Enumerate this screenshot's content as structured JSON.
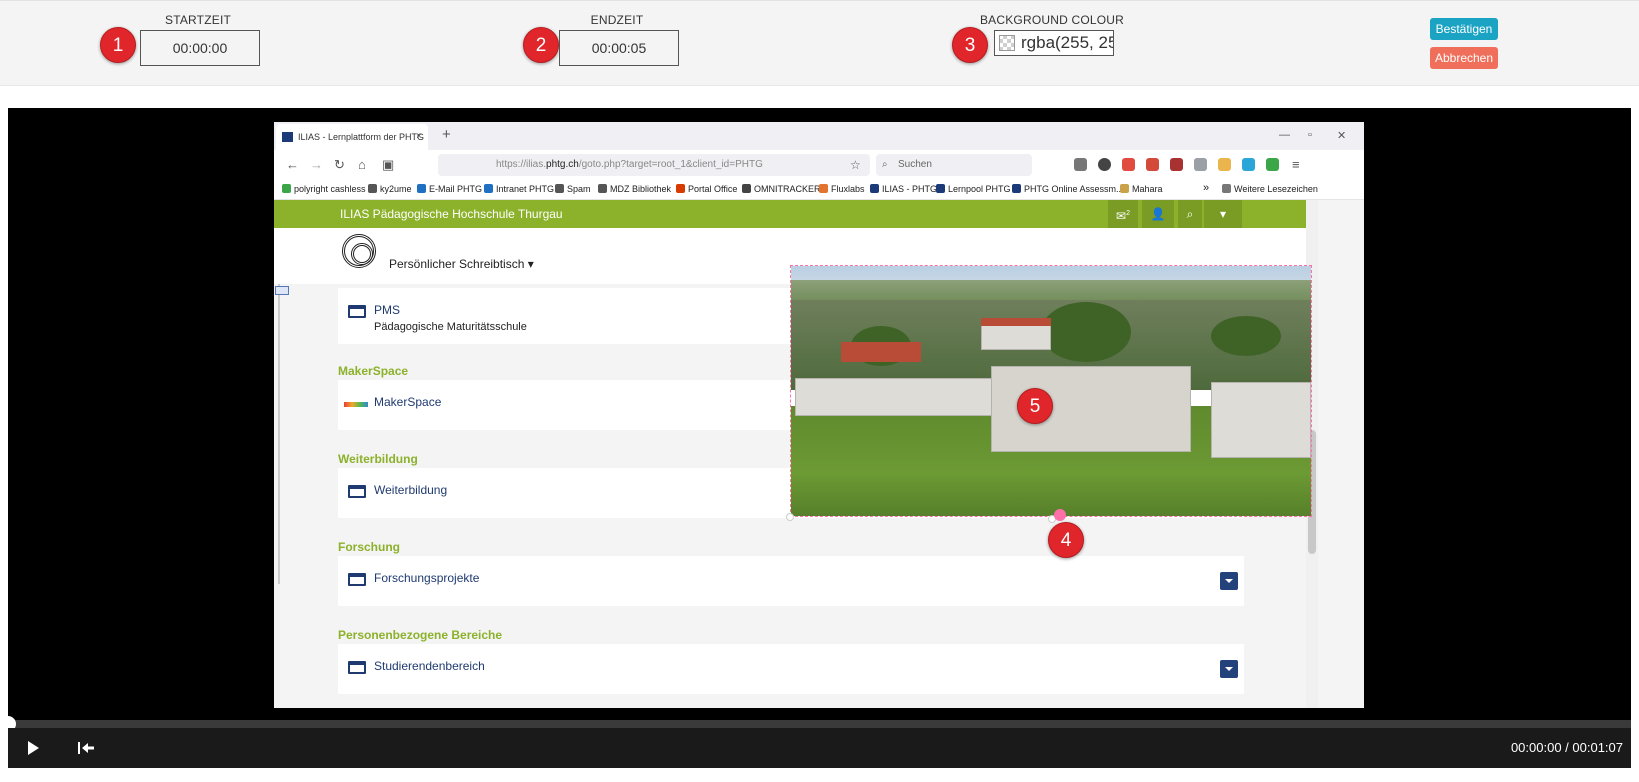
{
  "toolbar": {
    "start_label": "STARTZEIT",
    "start_value": "00:00:00",
    "end_label": "ENDZEIT",
    "end_value": "00:00:05",
    "bg_label": "BACKGROUND COLOUR",
    "bg_value": "rgba(255, 25",
    "confirm_label": "Bestätigen",
    "cancel_label": "Abbrechen"
  },
  "markers": [
    "1",
    "2",
    "3",
    "4",
    "5"
  ],
  "player": {
    "time": "00:00:00 / 00:01:07",
    "progress": 0
  },
  "browser": {
    "tab_title": "ILIAS - Lernplattform der PHTG",
    "tab_close": "×",
    "new_tab": "+",
    "url_rest_a": "https://ilias.",
    "url_host": "phtg.ch",
    "url_rest_b": "/goto.php?target=root_1&client_id=PHTG",
    "search_placeholder": "Suchen",
    "bookmarks": [
      "polyright cashless",
      "ky2ume",
      "E-Mail PHTG",
      "Intranet PHTG",
      "Spam",
      "MDZ Bibliothek",
      "Portal Office",
      "OMNITRACKER",
      "Fluxlabs",
      "ILIAS - PHTG",
      "Lernpool PHTG",
      "PHTG Online Assessm...",
      "Mahara"
    ],
    "bookmarks_more": "»",
    "other_bookmarks": "Weitere Lesezeichen"
  },
  "ilias": {
    "title": "ILIAS Pädagogische Hochschule Thurgau",
    "mail_count": "2",
    "desk_label": "Persönlicher Schreibtisch",
    "cards": [
      {
        "title": "PMS",
        "sub": "Pädagogische Maturitätsschule"
      },
      {
        "section": "MakerSpace",
        "title": "MakerSpace"
      },
      {
        "section": "Weiterbildung",
        "title": "Weiterbildung"
      },
      {
        "section": "Forschung",
        "title": "Forschungsprojekte"
      },
      {
        "section": "Personenbezogene Bereiche",
        "title": "Studierendenbereich"
      }
    ]
  },
  "colors": {
    "badge": "#e0262b",
    "confirm": "#1ba3c4",
    "cancel": "#f06f5a",
    "ilias_green": "#8cb12b",
    "overlay_border": "#ff6fa8"
  }
}
